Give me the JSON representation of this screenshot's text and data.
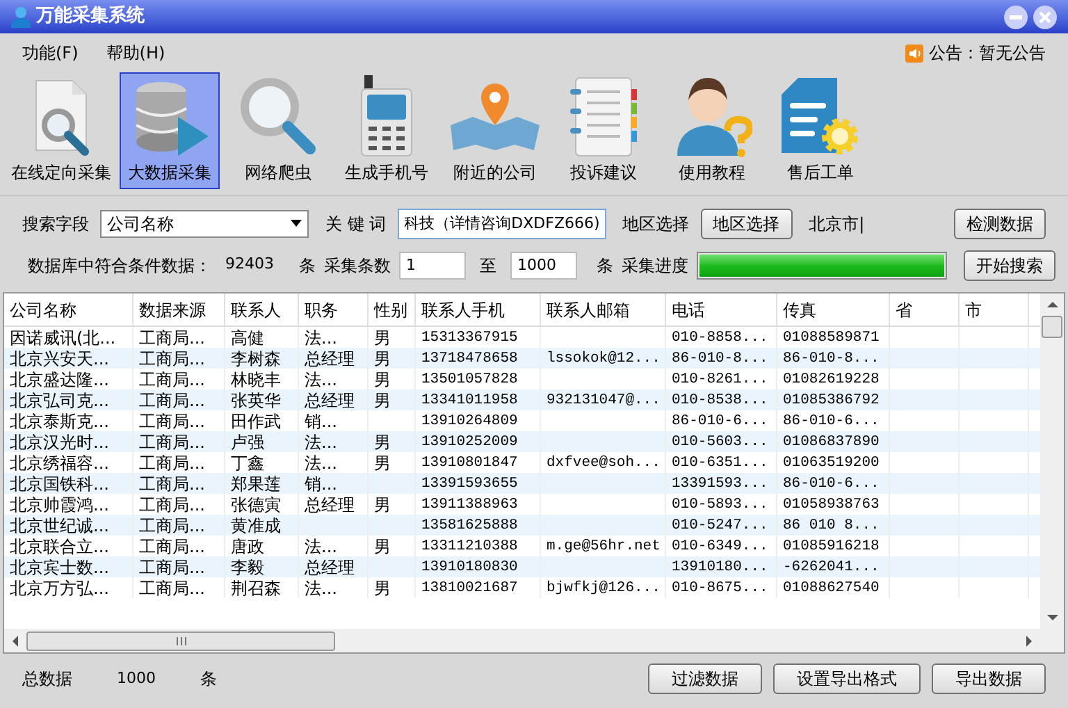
{
  "window": {
    "title": "万能采集系统"
  },
  "menu": [
    {
      "label": "功能(F)"
    },
    {
      "label": "帮助(H)"
    }
  ],
  "announcement": "公告：暂无公告",
  "toolbar": [
    {
      "label": "在线定向采集",
      "selected": false
    },
    {
      "label": "大数据采集",
      "selected": true
    },
    {
      "label": "网络爬虫",
      "selected": false
    },
    {
      "label": "生成手机号",
      "selected": false
    },
    {
      "label": "附近的公司",
      "selected": false
    },
    {
      "label": "投诉建议",
      "selected": false
    },
    {
      "label": "使用教程",
      "selected": false
    },
    {
      "label": "售后工单",
      "selected": false
    }
  ],
  "search": {
    "field_label": "搜索字段",
    "field_value": "公司名称",
    "keyword_label": "关 键 词",
    "keyword_value": "科技（详情咨询DXDFZ666)",
    "region_label": "地区选择",
    "region_button": "地区选择",
    "region_value": "北京市|",
    "check_button": "检测数据"
  },
  "collect": {
    "match_label": "数据库中符合条件数据：",
    "match_count": "92403",
    "unit1": "条",
    "count_label": "采集条数",
    "from": "1",
    "to_label": "至",
    "to": "1000",
    "unit2": "条",
    "progress_label": "采集进度",
    "level": 1,
    "start_button": "开始搜索"
  },
  "table": {
    "columns": [
      "公司名称",
      "数据来源",
      "联系人",
      "职务",
      "性别",
      "联系人手机",
      "联系人邮箱",
      "电话",
      "传真",
      "省",
      "市"
    ],
    "rows": [
      [
        "因诺威讯(北...",
        "工商局...",
        "高健",
        "法...",
        "男",
        "15313367915",
        "",
        "010-8858...",
        "01088589871",
        "",
        ""
      ],
      [
        "北京兴安天...",
        "工商局...",
        "李树森",
        "总经理",
        "男",
        "13718478658",
        "lssokok@12...",
        "86-010-8...",
        "86-010-8...",
        "",
        ""
      ],
      [
        "北京盛达隆...",
        "工商局...",
        "林晓丰",
        "法...",
        "男",
        "13501057828",
        "",
        "010-8261...",
        "01082619228",
        "",
        ""
      ],
      [
        "北京弘司克...",
        "工商局...",
        "张英华",
        "总经理",
        "男",
        "13341011958",
        "932131047@...",
        "010-8538...",
        "01085386792",
        "",
        ""
      ],
      [
        "北京泰斯克...",
        "工商局...",
        "田作武",
        "销...",
        "",
        "13910264809",
        "",
        "86-010-6...",
        "86-010-6...",
        "",
        ""
      ],
      [
        "北京汉光时...",
        "工商局...",
        "卢强",
        "法...",
        "男",
        "13910252009",
        "",
        "010-5603...",
        "01086837890",
        "",
        ""
      ],
      [
        "北京绣福容...",
        "工商局...",
        "丁鑫",
        "法...",
        "男",
        "13910801847",
        "dxfvee@soh...",
        "010-6351...",
        "01063519200",
        "",
        ""
      ],
      [
        "北京国铁科...",
        "工商局...",
        "郑果莲",
        "销...",
        "",
        "13391593655",
        "",
        "13391593...",
        "86-010-6...",
        "",
        ""
      ],
      [
        "北京帅霞鸿...",
        "工商局...",
        "张德寅",
        "总经理",
        "男",
        "13911388963",
        "",
        "010-5893...",
        "01058938763",
        "",
        ""
      ],
      [
        "北京世纪诚...",
        "工商局...",
        "黄准成",
        "",
        "",
        "13581625888",
        "",
        "010-5247...",
        "86 010 8...",
        "",
        ""
      ],
      [
        "北京联合立...",
        "工商局...",
        "唐政",
        "法...",
        "男",
        "13311210388",
        "m.ge@56hr.net",
        "010-6349...",
        "01085916218",
        "",
        ""
      ],
      [
        "北京宾士数...",
        "工商局...",
        "李毅",
        "总经理",
        "",
        "13910180830",
        "",
        "13910180...",
        "-6262041...",
        "",
        ""
      ],
      [
        "北京万方弘...",
        "工商局...",
        "荆召森",
        "法...",
        "男",
        "13810021687",
        "bjwfkj@126...",
        "010-8675...",
        "01088627540",
        "",
        ""
      ]
    ]
  },
  "status": {
    "total_label": "总数据",
    "total": "1000",
    "unit": "条",
    "buttons": [
      "过滤数据",
      "设置导出格式",
      "导出数据"
    ]
  }
}
